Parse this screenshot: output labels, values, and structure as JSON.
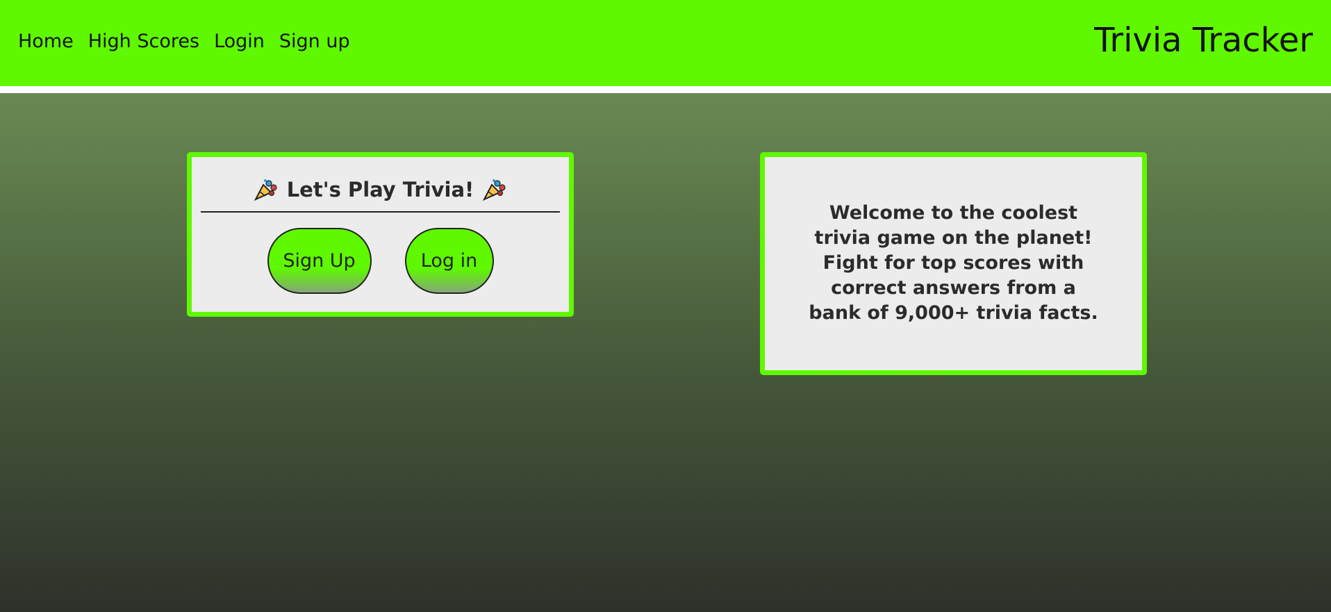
{
  "nav": {
    "links": [
      "Home",
      "High Scores",
      "Login",
      "Sign up"
    ],
    "brand": "Trivia Tracker"
  },
  "play_card": {
    "title": "Let's Play Trivia!",
    "left_icon": "party-popper-icon",
    "right_icon": "party-popper-icon",
    "signup_label": "Sign Up",
    "login_label": "Log in"
  },
  "welcome_card": {
    "text": "Welcome to the coolest trivia game on the planet! Fight for top scores with correct answers from a bank of 9,000+ trivia facts."
  },
  "colors": {
    "accent": "#5ff800",
    "card_bg": "#ececec"
  }
}
